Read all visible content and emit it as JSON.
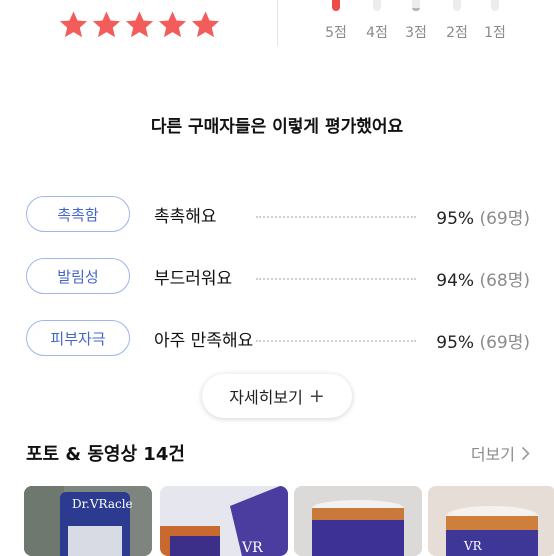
{
  "rating": {
    "stars": 5,
    "star_color": "#f45b5b"
  },
  "distribution": {
    "accent": "#ee4a4a",
    "items": [
      {
        "label": "5점",
        "fill": 1.0
      },
      {
        "label": "4점",
        "fill": 0.0
      },
      {
        "label": "3점",
        "fill": 0.3
      },
      {
        "label": "2점",
        "fill": 0.0
      },
      {
        "label": "1점",
        "fill": 0.0
      }
    ]
  },
  "subtitle": "다른 구매자들은 이렇게 평가했어요",
  "traits": [
    {
      "tag": "촉촉함",
      "text": "촉촉해요",
      "percent": "95%",
      "count": "(69명)"
    },
    {
      "tag": "발림성",
      "text": "부드러워요",
      "percent": "94%",
      "count": "(68명)"
    },
    {
      "tag": "피부자극",
      "text": "아주 만족해요",
      "percent": "95%",
      "count": "(69명)"
    }
  ],
  "more_button": {
    "label": "자세히보기",
    "icon": "plus-icon"
  },
  "photo_section": {
    "title": "포토 & 동영상 14건",
    "view_more": "더보기"
  },
  "thumbnails": [
    {
      "brand_text": "Dr.VRacle"
    },
    {
      "brand_text": "VR"
    },
    {
      "brand_text": ""
    },
    {
      "brand_text": "VR"
    }
  ]
}
